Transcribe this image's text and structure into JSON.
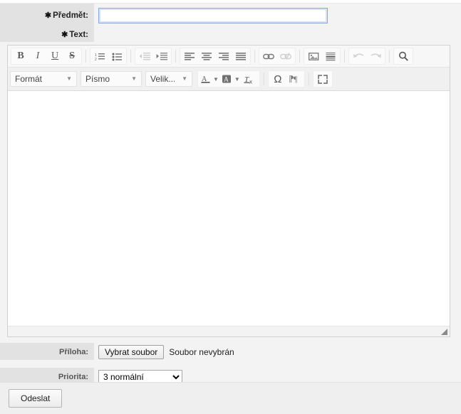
{
  "form": {
    "subject": {
      "label": "Předmět:",
      "required_marker": "✱",
      "value": "",
      "placeholder": ""
    },
    "text": {
      "label": "Text:",
      "required_marker": "✱",
      "body": ""
    },
    "attachment": {
      "label": "Příloha:",
      "button_label": "Vybrat soubor",
      "status": "Soubor nevybrán"
    },
    "priority": {
      "label": "Priorita:",
      "selected": "3 normální",
      "options": [
        "3 normální"
      ]
    },
    "submit_label": "Odeslat"
  },
  "editor": {
    "toolbar_row1": [
      {
        "name": "bold-icon",
        "glyph": "B",
        "title": "Bold",
        "disabled": false
      },
      {
        "name": "italic-icon",
        "glyph": "I",
        "title": "Italic",
        "disabled": false
      },
      {
        "name": "underline-icon",
        "glyph": "U",
        "title": "Underline",
        "disabled": false
      },
      {
        "name": "strikethrough-icon",
        "glyph": "S",
        "title": "Strikethrough",
        "disabled": false
      },
      {
        "name": "numbered-list-icon",
        "title": "Numbered list",
        "disabled": false
      },
      {
        "name": "bulleted-list-icon",
        "title": "Bulleted list",
        "disabled": false
      },
      {
        "name": "decrease-indent-icon",
        "title": "Decrease indent",
        "disabled": true
      },
      {
        "name": "increase-indent-icon",
        "title": "Increase indent",
        "disabled": false
      },
      {
        "name": "align-left-icon",
        "title": "Align left",
        "disabled": false
      },
      {
        "name": "align-center-icon",
        "title": "Align center",
        "disabled": false
      },
      {
        "name": "align-right-icon",
        "title": "Align right",
        "disabled": false
      },
      {
        "name": "align-justify-icon",
        "title": "Justify",
        "disabled": false
      },
      {
        "name": "insert-link-icon",
        "title": "Insert link",
        "disabled": false
      },
      {
        "name": "unlink-icon",
        "title": "Unlink",
        "disabled": true
      },
      {
        "name": "insert-image-icon",
        "title": "Insert image",
        "disabled": false
      },
      {
        "name": "insert-horizontal-rule-icon",
        "title": "Horizontal rule",
        "disabled": false
      },
      {
        "name": "undo-icon",
        "title": "Undo",
        "disabled": true
      },
      {
        "name": "redo-icon",
        "title": "Redo",
        "disabled": true
      },
      {
        "name": "find-icon",
        "title": "Find",
        "disabled": false
      }
    ],
    "toolbar_row2": {
      "format_label": "Formát",
      "font_label": "Písmo",
      "size_label": "Velik...",
      "buttons": [
        {
          "name": "text-color-icon",
          "glyph": "A",
          "title": "Text color"
        },
        {
          "name": "background-color-icon",
          "glyph": "A",
          "title": "Background color"
        },
        {
          "name": "remove-format-icon",
          "glyph": "Tx",
          "title": "Remove format"
        },
        {
          "name": "special-character-icon",
          "glyph": "Ω",
          "title": "Special character"
        },
        {
          "name": "text-direction-icon",
          "glyph": "¶",
          "title": "Text direction"
        },
        {
          "name": "maximize-icon",
          "title": "Maximize"
        }
      ]
    }
  },
  "colors": {
    "page_background": "#f3f3f3",
    "label_background": "#e2e2e2",
    "toolbar_background": "#f7f7f7",
    "toolbar_row2_background": "#f0f0f0",
    "editor_background": "#ffffff",
    "focus_border": "#8aa9dd",
    "footer_background": "#efefef"
  }
}
